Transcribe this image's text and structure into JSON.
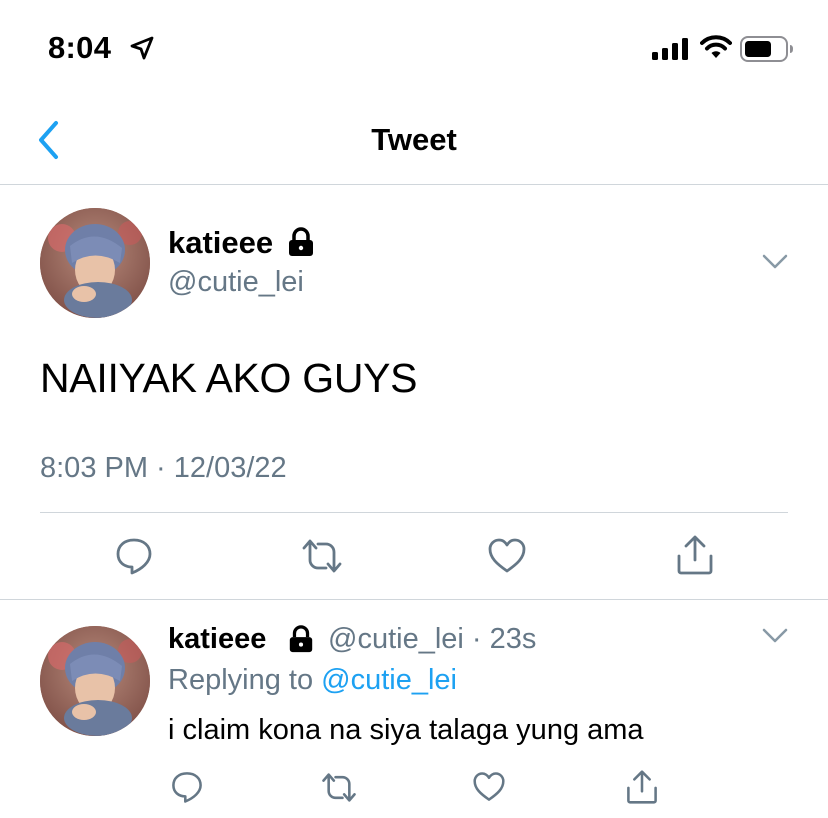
{
  "status_bar": {
    "time": "8:04",
    "location_icon": "location-arrow-icon",
    "signal_icon": "cellular-signal-icon",
    "wifi_icon": "wifi-icon",
    "battery_icon": "battery-icon"
  },
  "nav": {
    "back_icon": "chevron-left-icon",
    "title": "Tweet"
  },
  "main_tweet": {
    "display_name": "katieee",
    "protected_icon": "lock-icon",
    "handle": "@cutie_lei",
    "text": "NAIIYAK AKO GUYS",
    "timestamp": "8:03 PM · 12/03/22",
    "actions": [
      "reply-icon",
      "retweet-icon",
      "like-icon",
      "share-icon"
    ]
  },
  "reply_tweet": {
    "display_name": "katieee",
    "protected_icon": "lock-icon",
    "handle_time": "@cutie_lei · 23s",
    "replying_to_label": "Replying to ",
    "replying_to_user": "@cutie_lei",
    "text": "i claim kona na siya talaga yung ama",
    "actions": [
      "reply-icon",
      "retweet-icon",
      "like-icon",
      "share-icon"
    ]
  },
  "colors": {
    "accent": "#1da1f2",
    "secondary_text": "#657786",
    "divider": "#d0d6db",
    "icon_gray": "#657786"
  }
}
